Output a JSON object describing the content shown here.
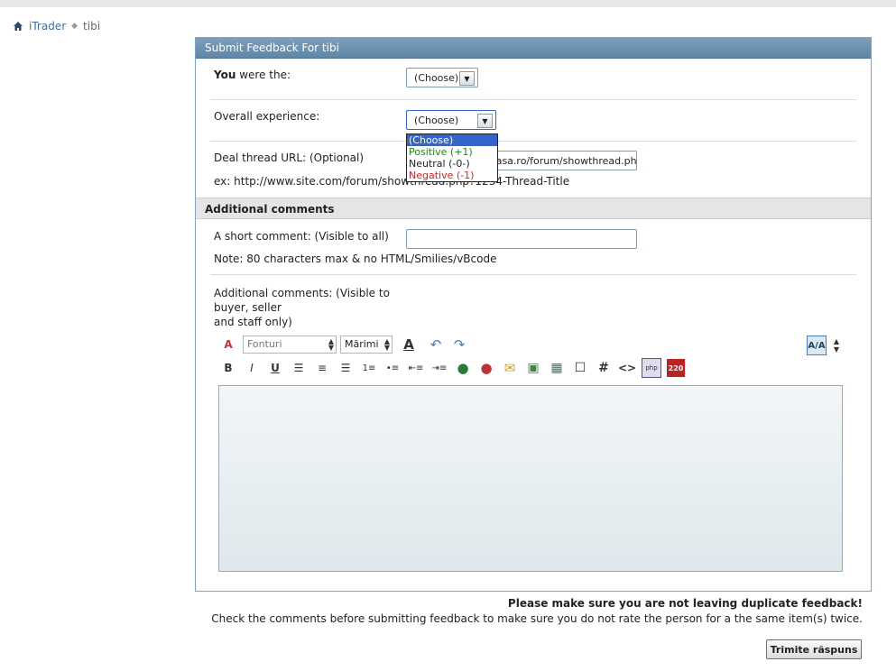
{
  "breadcrumb": {
    "home": "iTrader",
    "current": "tibi"
  },
  "panel": {
    "title": "Submit Feedback For tibi",
    "you_were_bold": "You",
    "you_were_rest": " were the:",
    "you_were_value": "(Choose)",
    "overall_label": "Overall experience:",
    "overall_value": "(Choose)",
    "overall_options": [
      "(Choose)",
      "Positive (+1)",
      "Neutral (-0-)",
      "Negative (-1)"
    ],
    "deal_label": "Deal thread URL: (Optional)",
    "deal_value": "masa.ro/forum/showthread.ph",
    "deal_example": "ex: http://www.site.com/forum/showthread.php?1234-Thread-Title",
    "section_title": "Additional comments",
    "short_label": "A short comment: (Visible to all)",
    "short_note": "Note: 80 characters max & no HTML/Smilies/vBcode",
    "additional_label_1": "Additional comments: (Visible to",
    "additional_label_2": "buyer, seller",
    "additional_label_3": "and staff only)",
    "font_combo": "Fonturi",
    "size_combo": "Mărimi"
  },
  "footer": {
    "warning": "Please make sure you are not leaving duplicate feedback!",
    "note": "Check the comments before submitting feedback to make sure you do not rate the person for a the same item(s) twice.",
    "submit": "Trimite răspuns"
  },
  "icons": [
    "home-icon",
    "remove-format-icon",
    "font-color-icon",
    "undo-icon",
    "redo-icon",
    "switch-mode-icon",
    "resize-icon",
    "bold-icon",
    "italic-icon",
    "underline-icon",
    "align-left-icon",
    "align-center-icon",
    "align-right-icon",
    "ordered-list-icon",
    "unordered-list-icon",
    "outdent-icon",
    "indent-icon",
    "link-icon",
    "unlink-icon",
    "email-icon",
    "image-icon",
    "video-icon",
    "quote-icon",
    "code-icon",
    "html-icon",
    "php-icon",
    "counter-icon"
  ]
}
